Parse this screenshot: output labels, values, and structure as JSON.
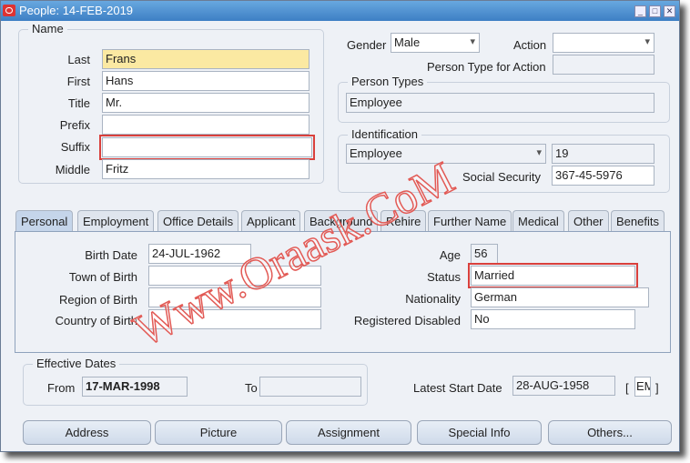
{
  "window": {
    "title": "People: 14-FEB-2019"
  },
  "name_group": {
    "label": "Name",
    "fields": [
      {
        "label": "Last",
        "value": "Frans"
      },
      {
        "label": "First",
        "value": "Hans"
      },
      {
        "label": "Title",
        "value": "Mr."
      },
      {
        "label": "Prefix",
        "value": ""
      },
      {
        "label": "Suffix",
        "value": ""
      },
      {
        "label": "Middle",
        "value": "Fritz"
      }
    ]
  },
  "gender": {
    "label": "Gender",
    "value": "Male"
  },
  "action": {
    "label": "Action",
    "value": ""
  },
  "person_type_for_action": {
    "label": "Person Type for Action",
    "value": ""
  },
  "person_types": {
    "label": "Person Types",
    "value": "Employee"
  },
  "identification": {
    "label": "Identification",
    "type": "Employee",
    "number": "19",
    "ssn_label": "Social Security",
    "ssn": "367-45-5976"
  },
  "tabs": [
    "Personal",
    "Employment",
    "Office Details",
    "Applicant",
    "Background",
    "Rehire",
    "Further Name",
    "Medical",
    "Other",
    "Benefits"
  ],
  "personal": {
    "birth_date": {
      "label": "Birth Date",
      "value": "24-JUL-1962"
    },
    "town": {
      "label": "Town of Birth",
      "value": ""
    },
    "region": {
      "label": "Region of Birth",
      "value": ""
    },
    "country": {
      "label": "Country of Birth",
      "value": ""
    },
    "age": {
      "label": "Age",
      "value": "56"
    },
    "status": {
      "label": "Status",
      "value": "Married"
    },
    "nationality": {
      "label": "Nationality",
      "value": "German"
    },
    "disabled": {
      "label": "Registered Disabled",
      "value": "No"
    }
  },
  "effective": {
    "label": "Effective Dates",
    "from_label": "From",
    "from": "17-MAR-1998",
    "to_label": "To",
    "to": ""
  },
  "latest_start": {
    "label": "Latest Start Date",
    "value": "28-AUG-1958",
    "bracket_open": "[",
    "code": "EM",
    "bracket_close": "]"
  },
  "buttons": [
    "Address",
    "Picture",
    "Assignment",
    "Special Info",
    "Others..."
  ],
  "watermark": "Www.Oraask.CoM",
  "colors": {
    "highlight": "#d9403c",
    "required": "#fbe9a2",
    "titlebar": "#3d7fc4"
  }
}
